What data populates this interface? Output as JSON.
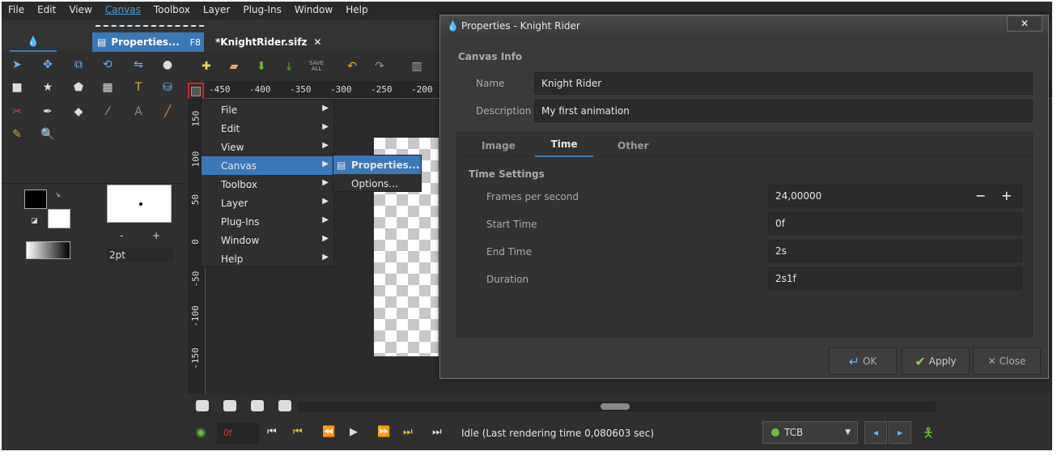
{
  "menubar": {
    "items": [
      "File",
      "Edit",
      "View",
      "Canvas",
      "Toolbox",
      "Layer",
      "Plug-Ins",
      "Window",
      "Help"
    ]
  },
  "tabs": {
    "properties": "Properties...",
    "properties_shortcut": "F8",
    "document": "*KnightRider.sifz",
    "close_glyph": "✕"
  },
  "brush": {
    "size": "2pt",
    "minus": "-",
    "plus": "+"
  },
  "ruler": {
    "h_ticks": [
      "-450",
      "-400",
      "-350",
      "-300",
      "-250",
      "-200"
    ],
    "v_ticks": [
      "150",
      "100",
      "50",
      "0",
      "-50",
      "-100",
      "-150"
    ]
  },
  "toolbar": {
    "save_all": "SAVE ALL"
  },
  "context_menu": {
    "items": [
      "File",
      "Edit",
      "View",
      "Canvas",
      "Toolbox",
      "Layer",
      "Plug-Ins",
      "Window",
      "Help"
    ],
    "submenu": [
      "Properties...",
      "Options..."
    ]
  },
  "timebar": {
    "current_frame": "0f",
    "status": "Idle (Last rendering time 0,080603 sec)",
    "interpolation": "TCB"
  },
  "dialog": {
    "title": "Properties - Knight Rider",
    "section": "Canvas Info",
    "name_label": "Name",
    "name_value": "Knight Rider",
    "desc_label": "Description",
    "desc_value": "My first animation",
    "tabs": [
      "Image",
      "Time",
      "Other"
    ],
    "time_settings": "Time Settings",
    "fps_label": "Frames per second",
    "fps_value": "24,00000",
    "start_label": "Start Time",
    "start_value": "0f",
    "end_label": "End Time",
    "end_value": "2s",
    "duration_label": "Duration",
    "duration_value": "2s1f",
    "ok": "OK",
    "apply": "Apply",
    "close": "Close",
    "close_glyph": "✕",
    "minus_glyph": "−",
    "plus_glyph": "+"
  },
  "colors": {
    "accent": "#3a78b8",
    "highlight_red": "#e02020"
  }
}
